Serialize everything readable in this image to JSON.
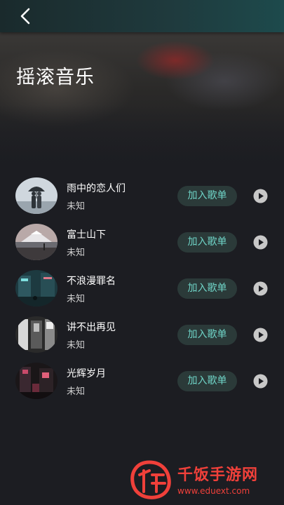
{
  "header": {
    "back_icon": "chevron-left-icon"
  },
  "page": {
    "title": "摇滚音乐"
  },
  "songs": [
    {
      "title": "雨中的恋人们",
      "artist": "未知",
      "add_label": "加入歌单",
      "cover": "couple-umbrella"
    },
    {
      "title": "富士山下",
      "artist": "未知",
      "add_label": "加入歌单",
      "cover": "mountain-lake"
    },
    {
      "title": "不浪漫罪名",
      "artist": "未知",
      "add_label": "加入歌单",
      "cover": "neon-street"
    },
    {
      "title": "讲不出再见",
      "artist": "未知",
      "add_label": "加入歌单",
      "cover": "bw-train"
    },
    {
      "title": "光辉岁月",
      "artist": "未知",
      "add_label": "加入歌单",
      "cover": "red-night"
    }
  ],
  "watermark": {
    "text": "千饭手游网",
    "url": "www.eduext.com"
  },
  "colors": {
    "accent": "#6fd4c7",
    "button_bg": "#2b3a39",
    "background": "#1c1d22",
    "watermark": "#f0403a"
  }
}
